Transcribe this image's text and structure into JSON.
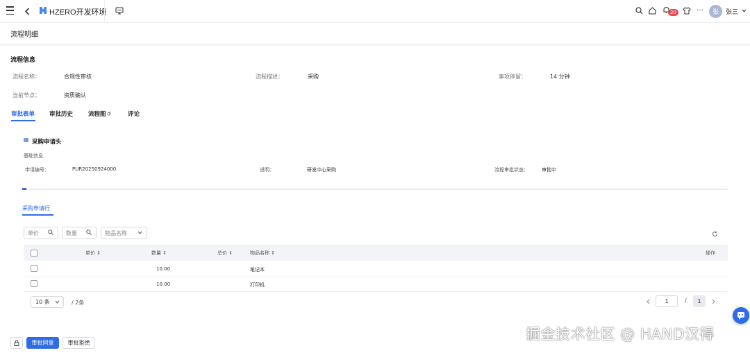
{
  "topbar": {
    "app_title": "HZERO开发环境",
    "notification_count": "20",
    "user_avatar": "张",
    "user_name": "张三"
  },
  "page": {
    "title": "流程明细"
  },
  "process_info": {
    "section_title": "流程信息",
    "name_label": "流程名称：",
    "name_value": "合规性审核",
    "desc_label": "流程描述：",
    "desc_value": "采购",
    "stay_label": "事项停留：",
    "stay_value": "14 分钟",
    "node_label": "当前节点：",
    "node_value": "资质确认"
  },
  "tabs": {
    "form": "审批表单",
    "history": "审批历史",
    "diagram": "流程图",
    "comments": "评论",
    "active": "form"
  },
  "purchase_header": {
    "title": "采购申请头",
    "basic_info": "基础信息",
    "req_no_label": "申请编号：",
    "req_no_value": "PUR20250924000",
    "desc_label": "说明：",
    "desc_value": "研发中心采购",
    "status_label": "流程审批状态：",
    "status_value": "审批中",
    "scroll_progress": 0.006
  },
  "purchase_lines": {
    "tab_label": "采购申请行",
    "filters": [
      {
        "placeholder": "单价",
        "icon": "search-icon"
      },
      {
        "placeholder": "数量",
        "icon": "search-icon"
      },
      {
        "placeholder": "物品名称",
        "icon": "chevron-down-icon"
      }
    ],
    "columns": {
      "unit_price": "单价",
      "quantity": "数量",
      "total": "总价",
      "item_name": "物品名称",
      "action": "操作"
    },
    "rows": [
      {
        "unit_price": "",
        "quantity": "10.00",
        "total": "",
        "item_name": "笔记本"
      },
      {
        "unit_price": "",
        "quantity": "10.00",
        "total": "",
        "item_name": "打印机"
      }
    ],
    "page_size": "10 条",
    "total_text": "/ 2条",
    "current_page": "1",
    "page_sep": "/",
    "total_pages": "1"
  },
  "footer": {
    "approve": "审批同意",
    "reject": "审批拒绝"
  },
  "watermark": "掘金技术社区 @ HAND汉得",
  "colors": {
    "primary": "#2e6be6",
    "badge": "#e8474b"
  }
}
